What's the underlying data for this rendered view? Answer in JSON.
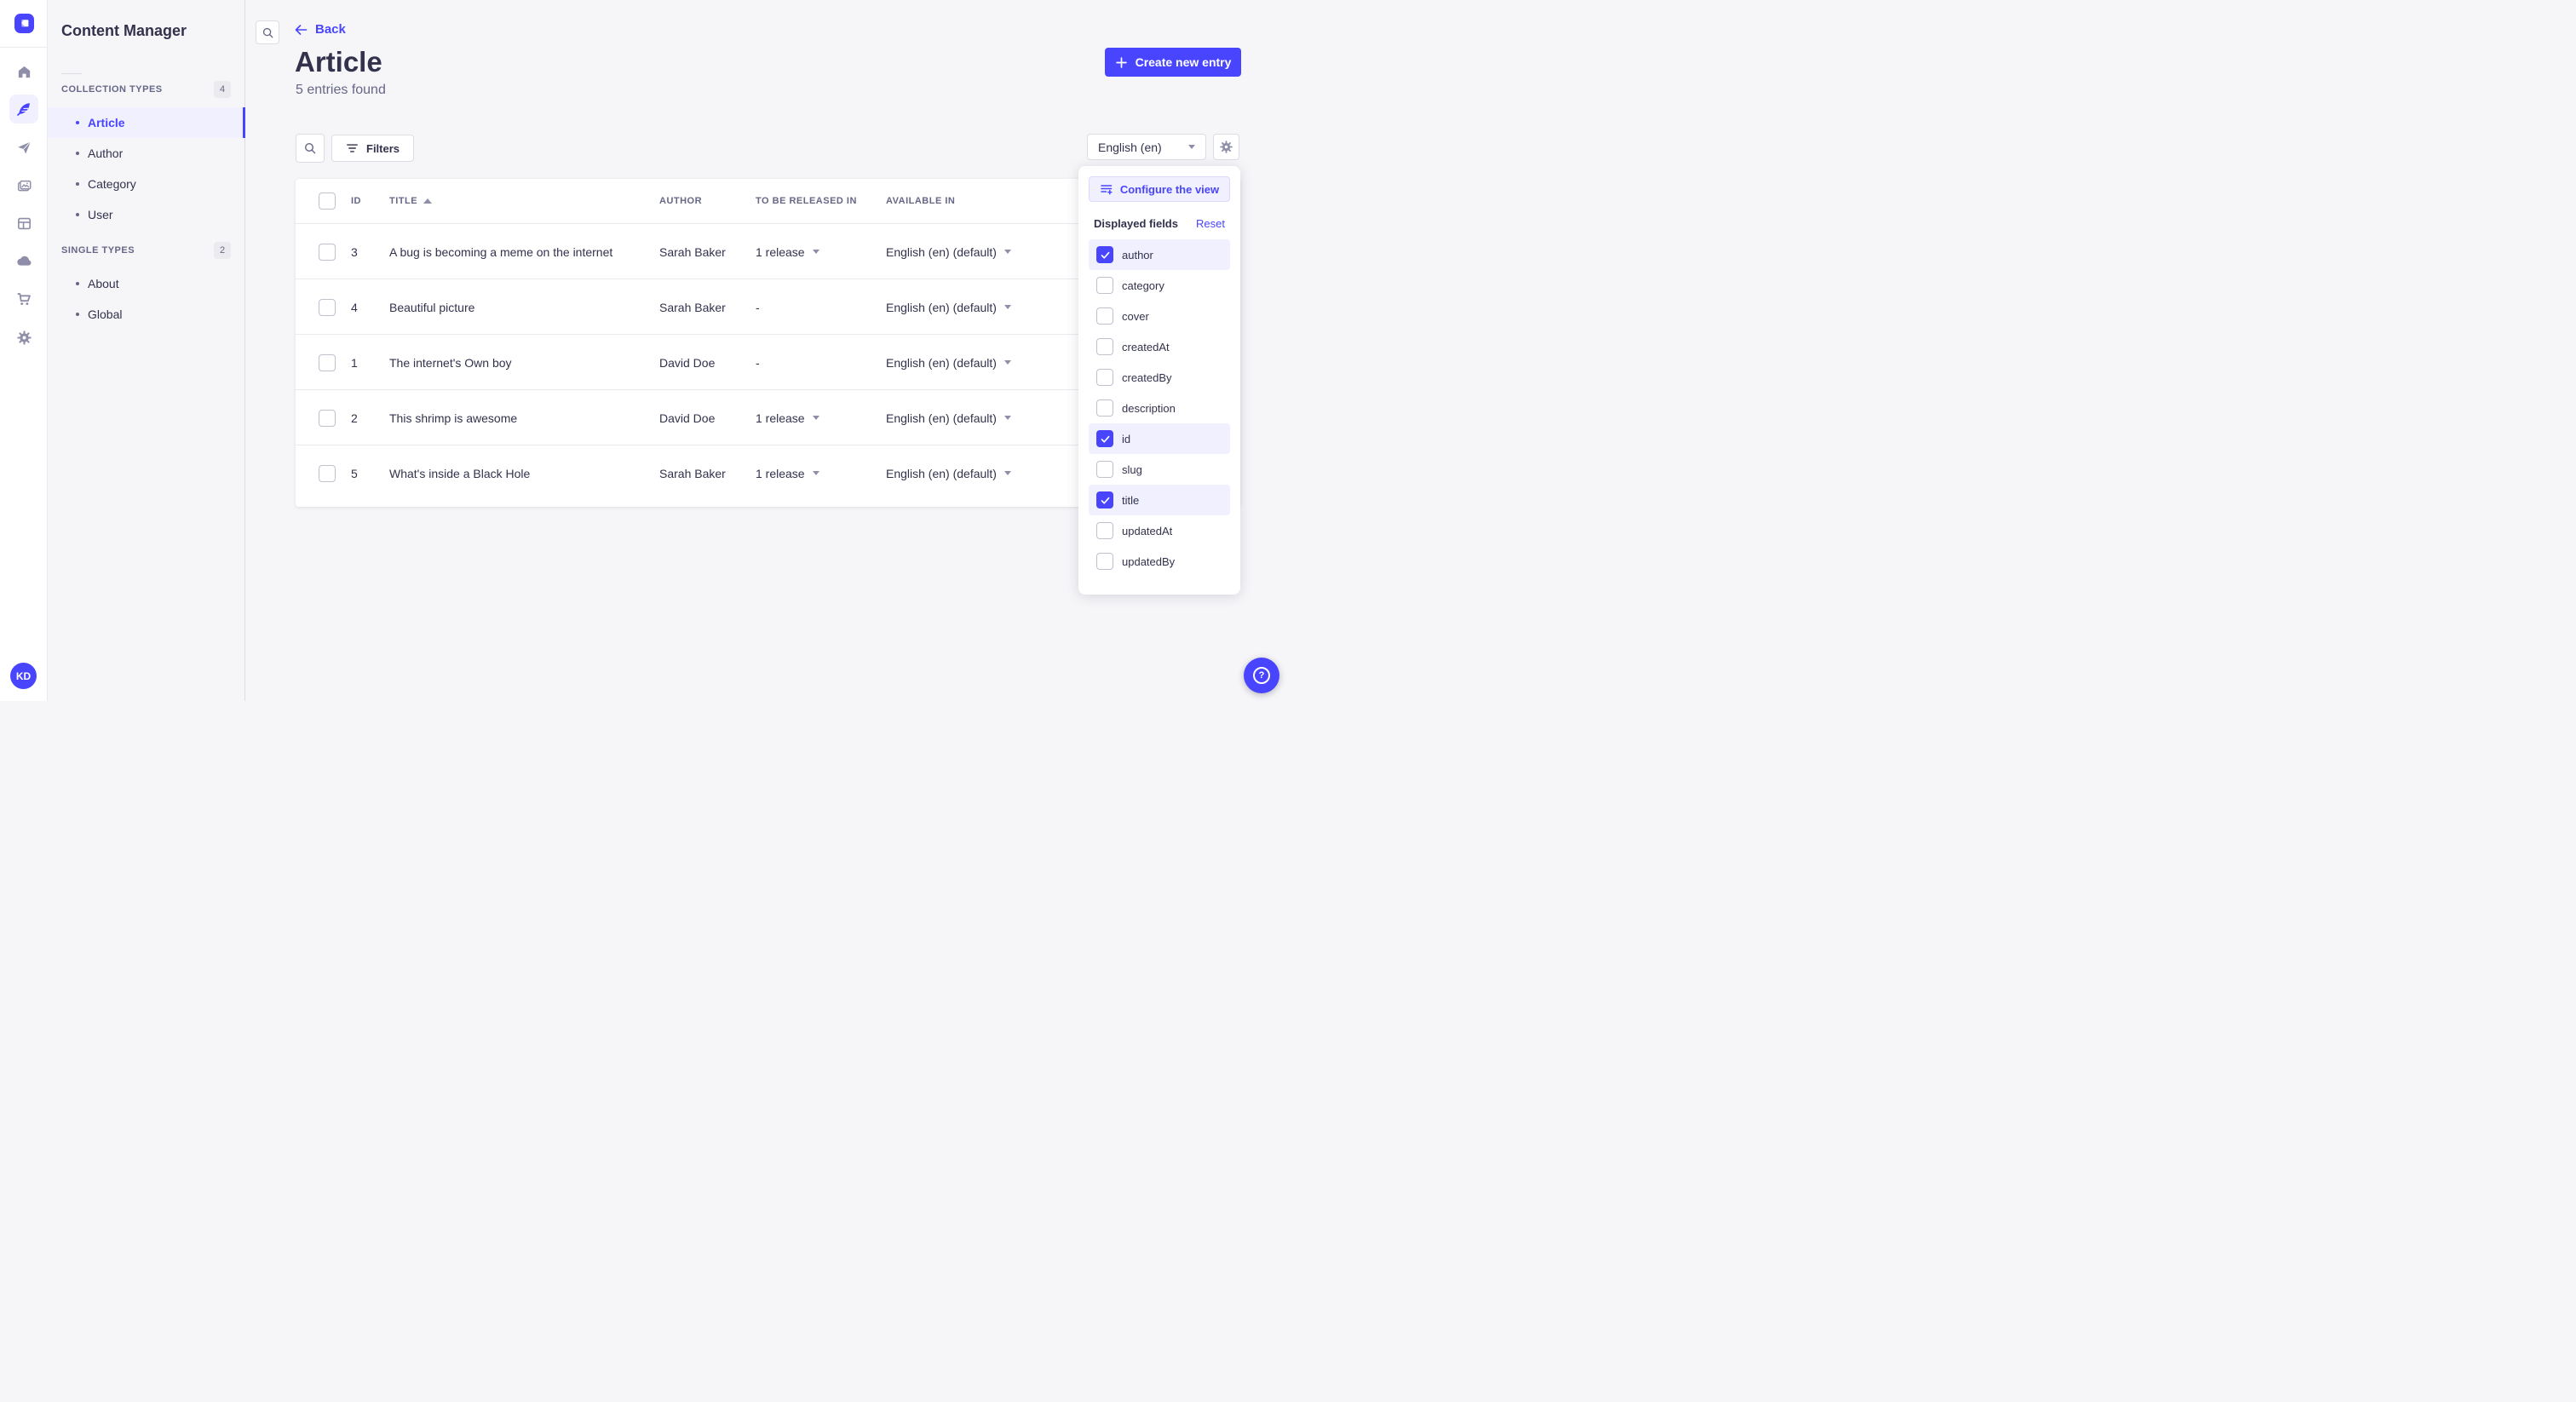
{
  "colors": {
    "primary": "#4945FF",
    "primary_light": "#F0F0FF",
    "primary_border": "#D9D8FF",
    "page_bg": "#F6F6F9",
    "surface": "#FFFFFF",
    "text_dark": "#32324D",
    "text_gray": "#666687",
    "icon_gray": "#8E8EA9",
    "border": "#DCDCE4",
    "divider": "#EAEAEF"
  },
  "rail": {
    "logo_icon": "strapi-logo",
    "icons": [
      "home-icon",
      "content-manager-feather-icon",
      "send-icon",
      "media-library-icon",
      "layout-icon",
      "cloud-icon",
      "cart-icon",
      "gear-icon"
    ],
    "active_icon": "content-manager-feather-icon",
    "user_initials": "KD"
  },
  "subnav": {
    "title": "Content Manager",
    "sections": [
      {
        "label": "COLLECTION TYPES",
        "badge": "4",
        "items": [
          {
            "label": "Article",
            "active": true
          },
          {
            "label": "Author",
            "active": false
          },
          {
            "label": "Category",
            "active": false
          },
          {
            "label": "User",
            "active": false
          }
        ]
      },
      {
        "label": "SINGLE TYPES",
        "badge": "2",
        "items": [
          {
            "label": "About",
            "active": false
          },
          {
            "label": "Global",
            "active": false
          }
        ]
      }
    ]
  },
  "header": {
    "back": "Back",
    "title": "Article",
    "subtitle": "5 entries found",
    "create_button": "Create new entry"
  },
  "toolbar": {
    "filters": "Filters",
    "locale": "English (en)"
  },
  "table": {
    "columns": [
      "ID",
      "TITLE",
      "AUTHOR",
      "TO BE RELEASED IN",
      "AVAILABLE IN"
    ],
    "sort": {
      "column": "TITLE",
      "direction": "ascending"
    },
    "rows": [
      {
        "id": "3",
        "title": "A bug is becoming a meme on the internet",
        "author": "Sarah Baker",
        "release": "1 release",
        "release_menu": true,
        "locale": "English (en) (default)"
      },
      {
        "id": "4",
        "title": "Beautiful picture",
        "author": "Sarah Baker",
        "release": "-",
        "release_menu": false,
        "locale": "English (en) (default)"
      },
      {
        "id": "1",
        "title": "The internet's Own boy",
        "author": "David Doe",
        "release": "-",
        "release_menu": false,
        "locale": "English (en) (default)"
      },
      {
        "id": "2",
        "title": "This shrimp is awesome",
        "author": "David Doe",
        "release": "1 release",
        "release_menu": true,
        "locale": "English (en) (default)"
      },
      {
        "id": "5",
        "title": "What's inside a Black Hole",
        "author": "Sarah Baker",
        "release": "1 release",
        "release_menu": true,
        "locale": "English (en) (default)"
      }
    ]
  },
  "popover": {
    "configure": "Configure the view",
    "heading": "Displayed fields",
    "reset": "Reset",
    "fields": [
      {
        "label": "author",
        "checked": true
      },
      {
        "label": "category",
        "checked": false
      },
      {
        "label": "cover",
        "checked": false
      },
      {
        "label": "createdAt",
        "checked": false
      },
      {
        "label": "createdBy",
        "checked": false
      },
      {
        "label": "description",
        "checked": false
      },
      {
        "label": "id",
        "checked": true
      },
      {
        "label": "slug",
        "checked": false
      },
      {
        "label": "title",
        "checked": true
      },
      {
        "label": "updatedAt",
        "checked": false
      },
      {
        "label": "updatedBy",
        "checked": false
      }
    ]
  },
  "help": {
    "glyph": "?"
  }
}
